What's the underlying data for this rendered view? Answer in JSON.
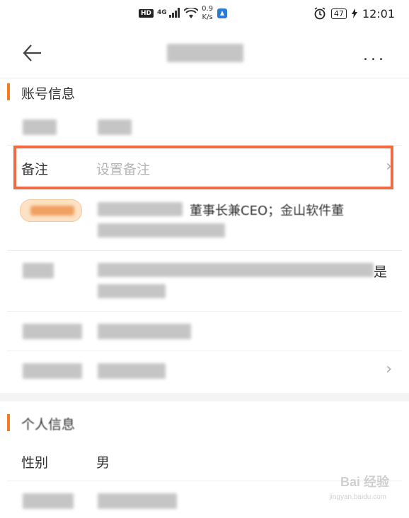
{
  "status_bar": {
    "hd": "HD",
    "network": "4G",
    "speed_value": "0.9",
    "speed_unit": "K/s",
    "battery": "47",
    "time": "12:01"
  },
  "header": {
    "more_label": "..."
  },
  "sections": {
    "account": {
      "title": "账号信息"
    },
    "personal": {
      "title": "个人信息"
    }
  },
  "rows": {
    "remark": {
      "label": "备注",
      "placeholder": "设置备注"
    },
    "signature_partial": "董事长兼CEO；金山软件董",
    "row5_tail": "是",
    "gender": {
      "label": "性别",
      "value": "男"
    }
  },
  "watermark": {
    "main": "Bai 经验",
    "sub": "jingyan.baidu.com"
  },
  "icons": {
    "back": "back-arrow-icon",
    "more": "more-dots-icon",
    "chevron": "chevron-right-icon"
  },
  "colors": {
    "accent": "#f57c22",
    "highlight": "#f26a42"
  }
}
